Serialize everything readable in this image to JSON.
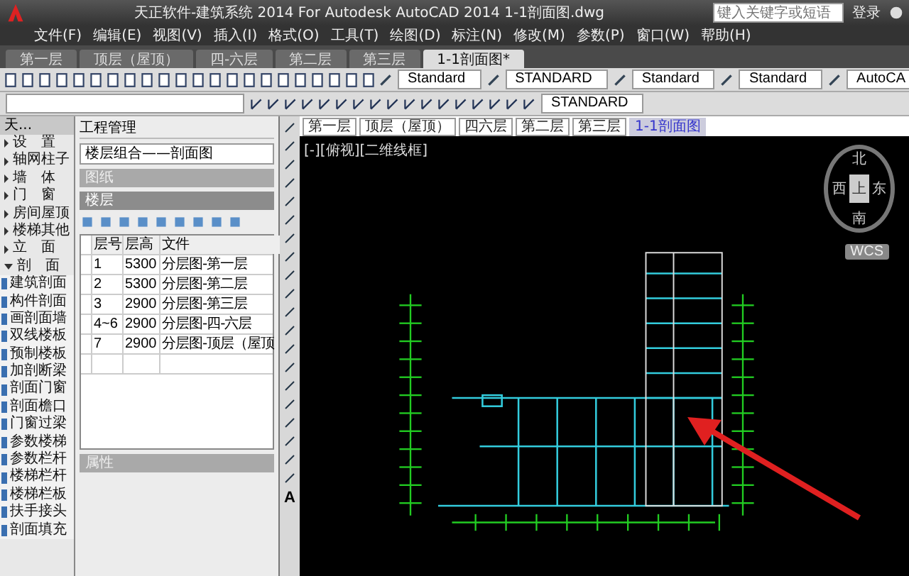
{
  "window": {
    "title": "天正软件-建筑系统 2014  For Autodesk AutoCAD 2014    1-1剖面图.dwg",
    "search": {
      "placeholder": "键入关键字或短语"
    },
    "sign_in": "登录"
  },
  "menu": [
    "文件(F)",
    "编辑(E)",
    "视图(V)",
    "插入(I)",
    "格式(O)",
    "工具(T)",
    "绘图(D)",
    "标注(N)",
    "修改(M)",
    "参数(P)",
    "窗口(W)",
    "帮助(H)"
  ],
  "document_tabs": [
    {
      "label": "第一层",
      "selected": false
    },
    {
      "label": "顶层（屋顶）",
      "selected": false
    },
    {
      "label": "四-六层",
      "selected": false
    },
    {
      "label": "第二层",
      "selected": false
    },
    {
      "label": "第三层",
      "selected": false
    },
    {
      "label": "1-1剖面图*",
      "selected": true
    }
  ],
  "style_combos": [
    {
      "value": "Standard"
    },
    {
      "value": "STANDARD"
    },
    {
      "value": "Standard"
    },
    {
      "value": "Standard"
    },
    {
      "value": "AutoCA"
    }
  ],
  "dim_style_combo": {
    "value": "STANDARD"
  },
  "tool_palette": {
    "title": "天...",
    "items": [
      {
        "label": "设　置",
        "expanded": false
      },
      {
        "label": "轴网柱子",
        "expanded": false
      },
      {
        "label": "墙　体",
        "expanded": false
      },
      {
        "label": "门　窗",
        "expanded": false
      },
      {
        "label": "房间屋顶",
        "expanded": false
      },
      {
        "label": "楼梯其他",
        "expanded": false
      },
      {
        "label": "立　面",
        "expanded": false
      },
      {
        "label": "剖　面",
        "expanded": true,
        "children": [
          {
            "label": "建筑剖面"
          },
          {
            "label": "构件剖面"
          },
          {
            "label": "画剖面墙"
          },
          {
            "label": "双线楼板"
          },
          {
            "label": "预制楼板"
          },
          {
            "label": "加剖断梁"
          },
          {
            "label": "剖面门窗"
          },
          {
            "label": "剖面檐口"
          },
          {
            "label": "门窗过梁"
          },
          {
            "label": "参数楼梯"
          },
          {
            "label": "参数栏杆"
          },
          {
            "label": "楼梯栏杆"
          },
          {
            "label": "楼梯栏板"
          },
          {
            "label": "扶手接头"
          },
          {
            "label": "剖面填充"
          }
        ]
      }
    ]
  },
  "project_manager": {
    "title": "工程管理",
    "project": "楼层组合——剖面图",
    "sections": [
      {
        "title": "图纸",
        "expanded": false
      },
      {
        "title": "楼层",
        "expanded": true
      }
    ],
    "floor_table": {
      "columns": [
        "层号",
        "层高",
        "文件"
      ],
      "rows": [
        {
          "cells": [
            "1",
            "5300",
            "分层图-第一层"
          ]
        },
        {
          "cells": [
            "2",
            "5300",
            "分层图-第二层"
          ]
        },
        {
          "cells": [
            "3",
            "2900",
            "分层图-第三层"
          ]
        },
        {
          "cells": [
            "4~6",
            "2900",
            "分层图-四-六层"
          ]
        },
        {
          "cells": [
            "7",
            "2900",
            "分层图-顶层（屋顶"
          ]
        }
      ]
    },
    "properties": {
      "title": "属性",
      "expanded": false
    }
  },
  "draw_toolbar": {
    "text_tool": "A"
  },
  "layout_tabs": [
    {
      "label": "第一层",
      "selected": false
    },
    {
      "label": "顶层（屋顶）",
      "selected": false
    },
    {
      "label": "四六层",
      "selected": false
    },
    {
      "label": "第二层",
      "selected": false
    },
    {
      "label": "第三层",
      "selected": false
    },
    {
      "label": "1-1剖面图",
      "selected": true
    }
  ],
  "viewport": {
    "label": "[-][俯视][二维线框]",
    "viewcube": {
      "face": "上",
      "north": "北",
      "east": "东",
      "south": "南",
      "west": "西"
    },
    "ucs": "WCS"
  }
}
